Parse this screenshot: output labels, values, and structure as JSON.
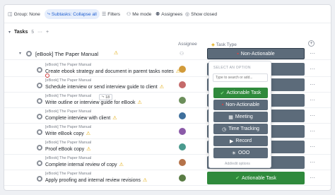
{
  "toolbar": {
    "group": "Group: None",
    "subtasks": "Subtasks: Collapse all",
    "filters": "Filters",
    "me_mode": "Me mode",
    "assignees": "Assignees",
    "show_closed": "Show closed"
  },
  "section": {
    "title": "Tasks",
    "count": "5",
    "more": "···",
    "add": "+"
  },
  "columns": {
    "assignee": "Assignee",
    "task_type": "Task Type"
  },
  "parent": {
    "name": "[eBook] The Paper Manual",
    "subtask_count": "18",
    "task_type": "Non-Actionable"
  },
  "rows": [
    {
      "crumb": "[eBook] The Paper Manual",
      "name": "Create ebook strategy and document in parent tasks notes",
      "type": "",
      "color": "gray"
    },
    {
      "crumb": "[eBook] The Paper Manual",
      "name": "Schedule interview or send interview guide to client",
      "type": "",
      "color": "gray"
    },
    {
      "crumb": "[eBook] The Paper Manual",
      "name": "Write outline or interview guide for eBook",
      "type": "",
      "color": "gray"
    },
    {
      "crumb": "[eBook] The Paper Manual",
      "name": "Complete interview with client",
      "type": "",
      "color": "gray"
    },
    {
      "crumb": "[eBook] The Paper Manual",
      "name": "Write eBook copy",
      "type": "",
      "color": "gray"
    },
    {
      "crumb": "[eBook] The Paper Manual",
      "name": "Proof eBook copy",
      "type": "",
      "color": "gray"
    },
    {
      "crumb": "[eBook] The Paper Manual",
      "name": "Complete internal review of copy",
      "type": "",
      "color": "gray"
    },
    {
      "crumb": "[eBook] The Paper Manual",
      "name": "Apply proofing and internal review revisions",
      "type": "Actionable Task",
      "color": "green"
    }
  ],
  "popup": {
    "header": "SELECT AN OPTION",
    "placeholder": "Type to search or add...",
    "options": [
      {
        "label": "Actionable Task",
        "icon": "check-icon",
        "color": "#2f8a3c"
      },
      {
        "label": "Non-Actionable",
        "icon": "redflag-icon",
        "color": "#5c6b7a"
      },
      {
        "label": "Meeting",
        "icon": "calendar-icon",
        "color": "#5c6b7a"
      },
      {
        "label": "Time Tracking",
        "icon": "clock-icon",
        "color": "#5c6b7a"
      },
      {
        "label": "Record",
        "icon": "video-icon",
        "color": "#5c6b7a"
      },
      {
        "label": "OOO",
        "icon": "sun-icon",
        "color": "#5c6b7a"
      }
    ],
    "footer": "Add/edit options"
  }
}
